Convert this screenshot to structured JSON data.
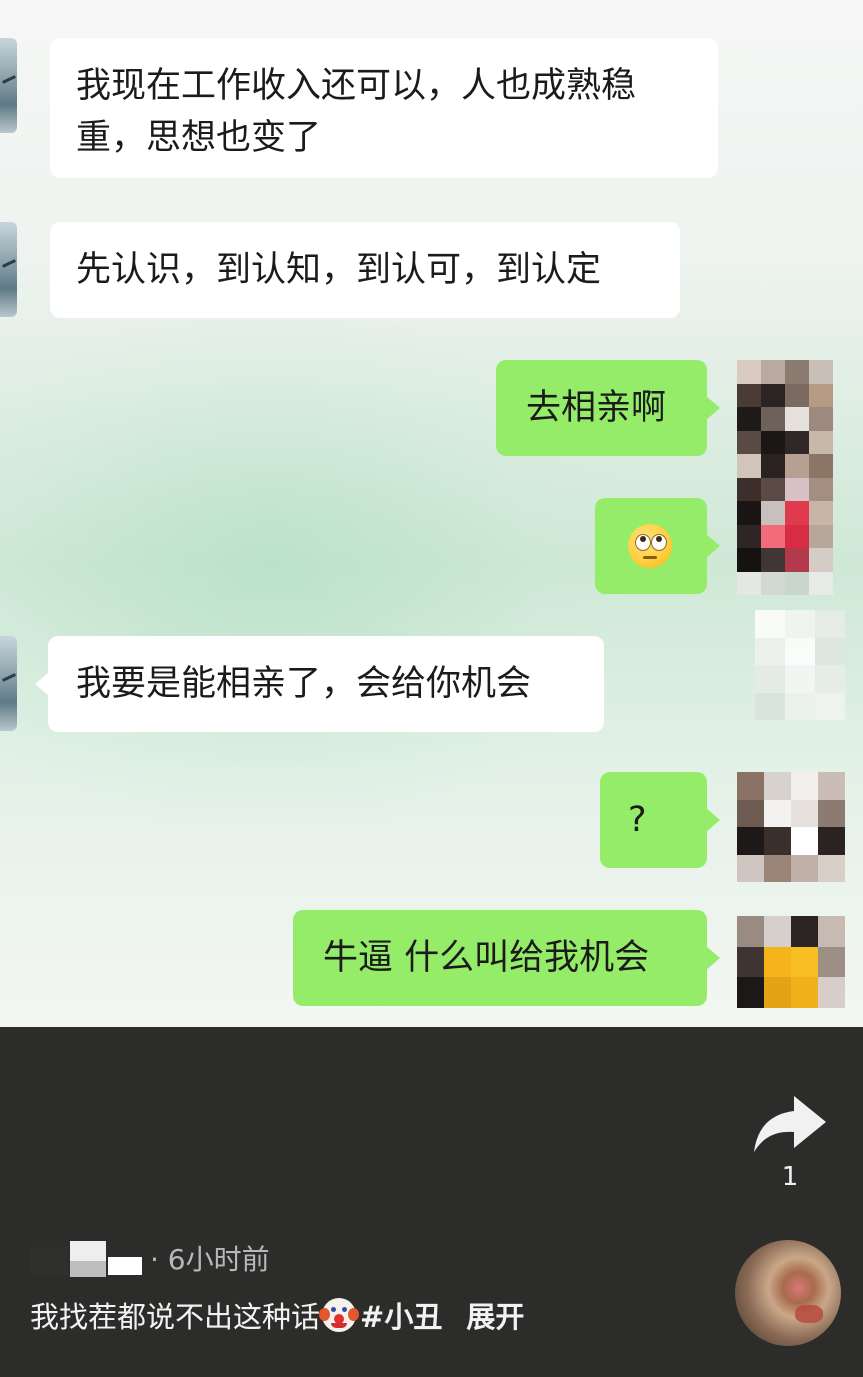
{
  "chat": {
    "messages": [
      {
        "side": "left",
        "text_line1": "我现在工作收入还可以，人也成熟稳",
        "text_line2": "重，思想也变了"
      },
      {
        "side": "left",
        "text": "先认识，到认知，到认可，到认定"
      },
      {
        "side": "right",
        "text": "去相亲啊"
      },
      {
        "side": "right",
        "emoji": "face-with-rolling-eyes"
      },
      {
        "side": "left",
        "text": "我要是能相亲了，会给你机会"
      },
      {
        "side": "right",
        "text": "?"
      },
      {
        "side": "right",
        "text": "牛逼 什么叫给我机会"
      }
    ]
  },
  "video": {
    "share_count": "1",
    "time_ago": "· 6小时前",
    "caption_text": "我找茬都说不出这种话",
    "caption_emoji": "clown-face",
    "hashtag": "#小丑",
    "expand_label": "展开"
  },
  "colors": {
    "sent_bubble": "#95ec69",
    "received_bubble": "#ffffff",
    "panel_bg": "#2c2c2a"
  },
  "icons": [
    "share-arrow-icon",
    "music-disc-icon",
    "clown-emoji-icon",
    "rolling-eyes-emoji-icon"
  ]
}
